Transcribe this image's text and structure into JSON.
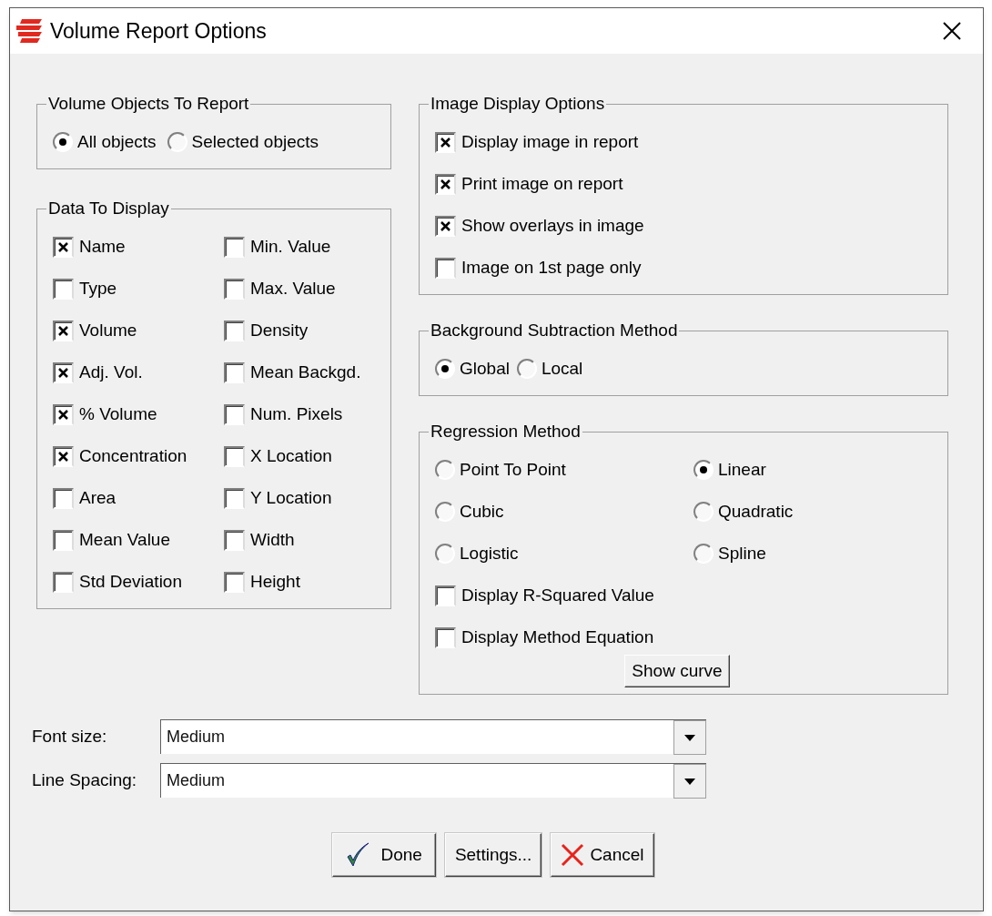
{
  "window": {
    "title": "Volume Report Options"
  },
  "volume_objects": {
    "title": "Volume Objects To Report",
    "options": [
      {
        "label": "All objects",
        "selected": true
      },
      {
        "label": "Selected objects",
        "selected": false
      }
    ]
  },
  "data_to_display": {
    "title": "Data To Display",
    "items": [
      {
        "label": "Name",
        "checked": true
      },
      {
        "label": "Min. Value",
        "checked": false
      },
      {
        "label": "Type",
        "checked": false
      },
      {
        "label": "Max. Value",
        "checked": false
      },
      {
        "label": "Volume",
        "checked": true
      },
      {
        "label": "Density",
        "checked": false
      },
      {
        "label": "Adj. Vol.",
        "checked": true
      },
      {
        "label": "Mean Backgd.",
        "checked": false
      },
      {
        "label": "% Volume",
        "checked": true
      },
      {
        "label": "Num. Pixels",
        "checked": false
      },
      {
        "label": "Concentration",
        "checked": true
      },
      {
        "label": "X Location",
        "checked": false
      },
      {
        "label": "Area",
        "checked": false
      },
      {
        "label": "Y Location",
        "checked": false
      },
      {
        "label": "Mean Value",
        "checked": false
      },
      {
        "label": "Width",
        "checked": false
      },
      {
        "label": "Std Deviation",
        "checked": false
      },
      {
        "label": "Height",
        "checked": false
      }
    ]
  },
  "image_display": {
    "title": "Image Display Options",
    "items": [
      {
        "label": "Display image in report",
        "checked": true
      },
      {
        "label": "Print image on report",
        "checked": true
      },
      {
        "label": "Show overlays in image",
        "checked": true
      },
      {
        "label": "Image on 1st page only",
        "checked": false
      }
    ]
  },
  "background_subtraction": {
    "title": "Background Subtraction Method",
    "options": [
      {
        "label": "Global",
        "selected": true
      },
      {
        "label": "Local",
        "selected": false
      }
    ]
  },
  "regression": {
    "title": "Regression Method",
    "methods": [
      {
        "label": "Point To Point",
        "selected": false
      },
      {
        "label": "Linear",
        "selected": true
      },
      {
        "label": "Cubic",
        "selected": false
      },
      {
        "label": "Quadratic",
        "selected": false
      },
      {
        "label": "Logistic",
        "selected": false
      },
      {
        "label": "Spline",
        "selected": false
      }
    ],
    "checks": [
      {
        "label": "Display R-Squared Value",
        "checked": false
      },
      {
        "label": "Display Method Equation",
        "checked": false
      }
    ],
    "button": "Show curve"
  },
  "font_size": {
    "label": "Font size:",
    "value": "Medium"
  },
  "line_spacing": {
    "label": "Line Spacing:",
    "value": "Medium"
  },
  "buttons": [
    {
      "kind": "done",
      "label": "Done"
    },
    {
      "kind": "settings",
      "label": "Settings..."
    },
    {
      "kind": "cancel",
      "label": "Cancel"
    }
  ]
}
